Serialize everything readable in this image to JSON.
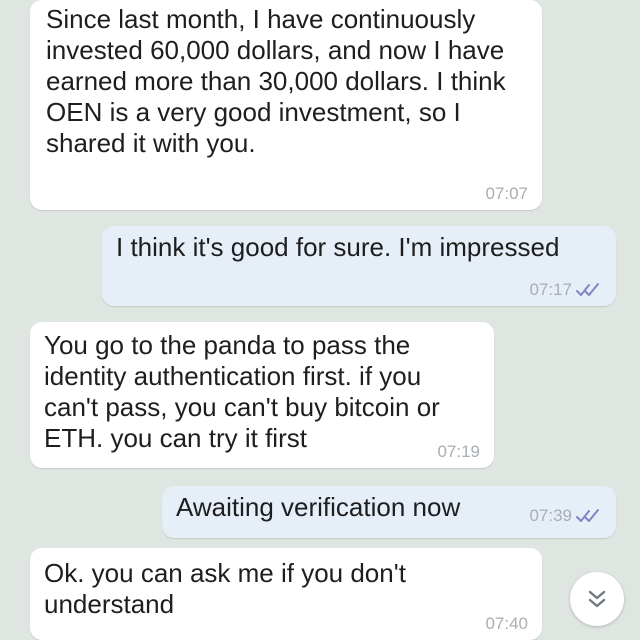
{
  "messages": [
    {
      "direction": "incoming",
      "text": "Since last month, I have continuously invested 60,000 dollars, and now I have earned more than 30,000 dollars. I think OEN is a very good investment, so I shared it with you.",
      "time": "07:07"
    },
    {
      "direction": "outgoing",
      "text": "I think it's good for sure. I'm impressed",
      "time": "07:17",
      "status": "read-double-check-icon"
    },
    {
      "direction": "incoming",
      "text": "You go to the panda to pass the identity authentication first. if you can't pass, you can't buy bitcoin or ETH. you can try it first",
      "time": "07:19"
    },
    {
      "direction": "outgoing",
      "text": "Awaiting verification now",
      "time": "07:39",
      "status": "read-double-check-icon"
    },
    {
      "direction": "incoming",
      "text": "Ok. you can ask me if you don't understand",
      "time": "07:40"
    }
  ],
  "scroll_button": {
    "icon": "double-chevron-down-icon"
  },
  "colors": {
    "background": "#dfe5e0",
    "incoming_bubble": "#ffffff",
    "outgoing_bubble": "#e6eef8",
    "check_color": "#7f86c4",
    "timestamp": "#a9aeb2"
  }
}
